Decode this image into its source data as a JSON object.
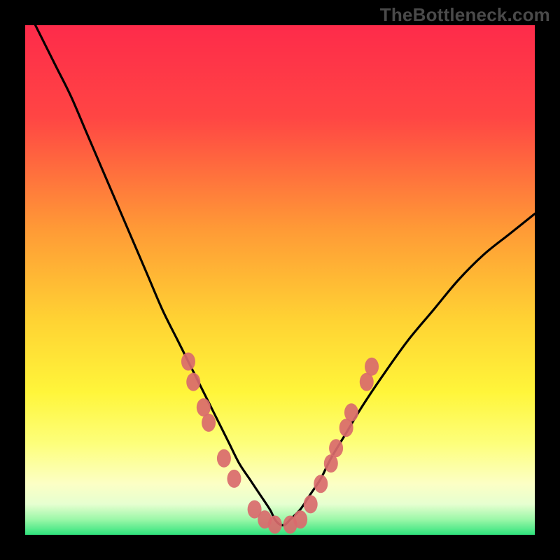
{
  "watermark": "TheBottleneck.com",
  "colors": {
    "frame": "#000000",
    "gradient_top": "#fe2b4a",
    "gradient_mid1": "#ff6a3f",
    "gradient_mid2": "#ffd433",
    "gradient_mid3": "#fff83a",
    "gradient_low": "#f9ffb0",
    "gradient_bottom": "#30e87d",
    "curve": "#000000",
    "markers": "#d96a6c"
  },
  "chart_data": {
    "type": "line",
    "title": "",
    "xlabel": "",
    "ylabel": "",
    "ylim": [
      0,
      100
    ],
    "xlim": [
      0,
      100
    ],
    "x": [
      0,
      3,
      6,
      9,
      12,
      15,
      18,
      21,
      24,
      27,
      30,
      33,
      36,
      38,
      40,
      42,
      44,
      46,
      48,
      49,
      50,
      51,
      52,
      54,
      56,
      58,
      60,
      63,
      66,
      70,
      75,
      80,
      85,
      90,
      95,
      100
    ],
    "values": [
      104,
      98,
      92,
      86,
      79,
      72,
      65,
      58,
      51,
      44,
      38,
      32,
      26,
      22,
      18,
      14,
      11,
      8,
      5,
      3,
      2,
      2,
      3,
      5,
      8,
      11,
      15,
      20,
      25,
      31,
      38,
      44,
      50,
      55,
      59,
      63
    ],
    "markers": [
      {
        "x": 32,
        "y": 34
      },
      {
        "x": 33,
        "y": 30
      },
      {
        "x": 35,
        "y": 25
      },
      {
        "x": 36,
        "y": 22
      },
      {
        "x": 39,
        "y": 15
      },
      {
        "x": 41,
        "y": 11
      },
      {
        "x": 45,
        "y": 5
      },
      {
        "x": 47,
        "y": 3
      },
      {
        "x": 49,
        "y": 2
      },
      {
        "x": 52,
        "y": 2
      },
      {
        "x": 54,
        "y": 3
      },
      {
        "x": 56,
        "y": 6
      },
      {
        "x": 58,
        "y": 10
      },
      {
        "x": 60,
        "y": 14
      },
      {
        "x": 61,
        "y": 17
      },
      {
        "x": 63,
        "y": 21
      },
      {
        "x": 64,
        "y": 24
      },
      {
        "x": 67,
        "y": 30
      },
      {
        "x": 68,
        "y": 33
      }
    ]
  }
}
